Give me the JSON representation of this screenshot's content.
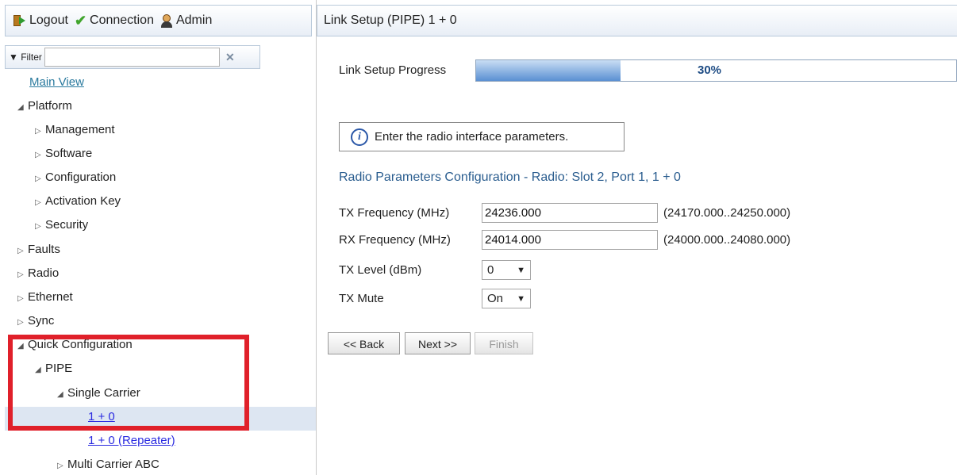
{
  "topbar": {
    "logout_label": "Logout",
    "connection_label": "Connection",
    "admin_label": "Admin"
  },
  "filter": {
    "label": "▼ Filter",
    "value": "",
    "clear_icon": "close-icon"
  },
  "tree": {
    "main_view": "Main View",
    "platform": "Platform",
    "management": "Management",
    "software": "Software",
    "configuration": "Configuration",
    "activation_key": "Activation Key",
    "security": "Security",
    "faults": "Faults",
    "radio": "Radio",
    "ethernet": "Ethernet",
    "sync": "Sync",
    "quick_configuration": "Quick Configuration",
    "pipe": "PIPE",
    "single_carrier": "Single Carrier",
    "one_plus_zero": "1 + 0",
    "one_plus_zero_repeater": "1 + 0 (Repeater)",
    "multi_carrier_abc": "Multi Carrier ABC"
  },
  "main": {
    "header_title": "Link Setup (PIPE) 1 + 0",
    "progress": {
      "label": "Link Setup Progress",
      "percent_text": "30%",
      "value": 0.3
    },
    "info_text": "Enter the radio interface parameters.",
    "section_title": "Radio Parameters Configuration - Radio: Slot 2, Port 1, 1 + 0",
    "fields": {
      "tx_freq_label": "TX Frequency (MHz)",
      "tx_freq_value": "24236.000",
      "tx_freq_range": "(24170.000..24250.000)",
      "rx_freq_label": "RX Frequency (MHz)",
      "rx_freq_value": "24014.000",
      "rx_freq_range": "(24000.000..24080.000)",
      "tx_level_label": "TX Level (dBm)",
      "tx_level_value": "0",
      "tx_mute_label": "TX Mute",
      "tx_mute_value": "On"
    },
    "buttons": {
      "back": "<< Back",
      "next": "Next >>",
      "finish": "Finish"
    }
  },
  "colors": {
    "highlight_box": "#e0202a",
    "link": "#2a2ae0",
    "section_title": "#2a5d8f",
    "progress_fill": "#5a8fd2"
  }
}
